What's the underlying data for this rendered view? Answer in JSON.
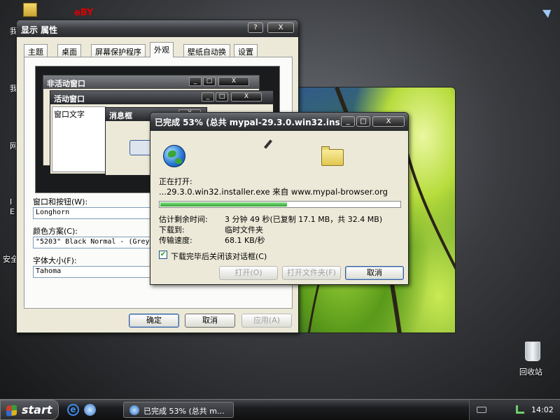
{
  "desktop": {
    "icons": [
      {
        "label": "我"
      },
      {
        "label": "我"
      },
      {
        "label": "网"
      },
      {
        "label": "I E"
      },
      {
        "label": "安全"
      },
      {
        "label": "回收站"
      }
    ]
  },
  "display_properties": {
    "title": "显示 属性",
    "title_buttons": [
      "?",
      "X"
    ],
    "tabs": [
      "主题",
      "桌面",
      "屏幕保护程序",
      "外观",
      "壁纸自动换",
      "设置"
    ],
    "selected_tab": "外观",
    "preview": {
      "inactive_title": "非活动窗口",
      "active_title": "活动窗口",
      "window_text": "窗口文字",
      "message_box_title": "消息框"
    },
    "windows_buttons_label": "窗口和按钮(W):",
    "windows_buttons_value": "Longhorn",
    "color_scheme_label": "颜色方案(C):",
    "color_scheme_value": "\"5203\" Black Normal - (Grey",
    "font_size_label": "字体大小(F):",
    "font_size_value": "Tahoma",
    "ok_label": "确定",
    "cancel_label": "取消",
    "apply_label": "应用(A)"
  },
  "download_dialog": {
    "title": "已完成 53% (总共 mypal-29.3.0.win32.ins...",
    "buttons": [
      "_",
      "□",
      "X"
    ],
    "opening_label": "正在打开:",
    "file_line": "...29.3.0.win32.installer.exe 来自 www.mypal-browser.org",
    "progress": 0.53,
    "time_left_label": "估计剩余时间:",
    "time_left_value": "3 分钟 49 秒(已复制 17.1 MB，共 32.4 MB)",
    "download_to_label": "下载到:",
    "download_to_value": "临时文件夹",
    "rate_label": "传输速度:",
    "rate_value": "68.1 KB/秒",
    "close_checkbox_label": "下载完毕后关闭该对话框(C)",
    "close_checkbox_checked": true,
    "open_button": "打开(O)",
    "open_folder_button": "打开文件夹(F)",
    "cancel_button": "取消"
  },
  "taskbar": {
    "start_label": "start",
    "task_label": "已完成 53% (总共 m...",
    "clock": "14:02"
  }
}
